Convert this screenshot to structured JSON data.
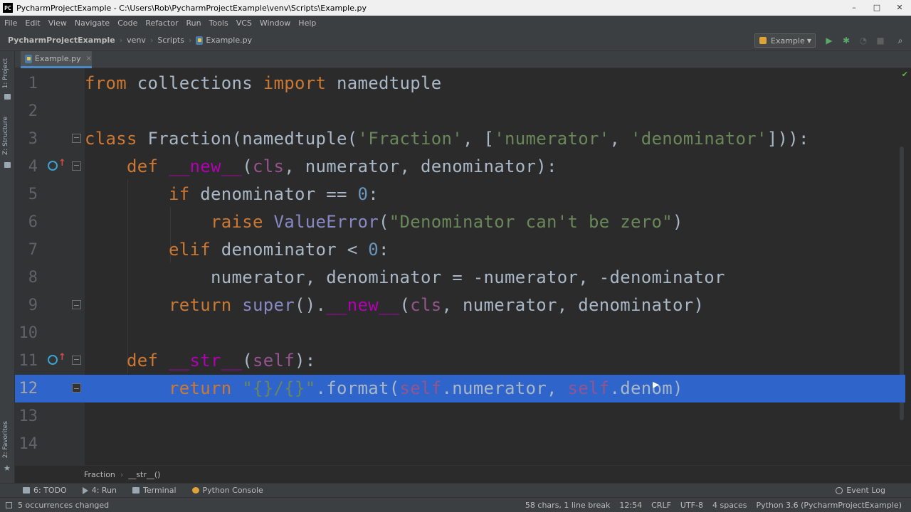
{
  "window": {
    "title": "PycharmProjectExample - C:\\Users\\Rob\\PycharmProjectExample\\venv\\Scripts\\Example.py",
    "app_icon_text": "PC",
    "controls": [
      "–",
      "□",
      "✕"
    ]
  },
  "menu": [
    "File",
    "Edit",
    "View",
    "Navigate",
    "Code",
    "Refactor",
    "Run",
    "Tools",
    "VCS",
    "Window",
    "Help"
  ],
  "navbar": {
    "breadcrumbs": [
      "PycharmProjectExample",
      "venv",
      "Scripts",
      "Example.py"
    ],
    "run_config": "Example"
  },
  "left_strip": {
    "project": "1: Project",
    "structure": "Z: Structure",
    "favorites": "2: Favorites"
  },
  "tabs": [
    {
      "label": "Example.py",
      "close": "×"
    }
  ],
  "editor": {
    "line_numbers": [
      "1",
      "2",
      "3",
      "4",
      "5",
      "6",
      "7",
      "8",
      "9",
      "10",
      "11",
      "12",
      "13",
      "14"
    ]
  },
  "code_breadcrumb": [
    "Fraction",
    "__str__()"
  ],
  "tool_windows": {
    "todo": "6: TODO",
    "run": "4: Run",
    "terminal": "Terminal",
    "python_console": "Python Console",
    "event_log": "Event Log"
  },
  "status": {
    "message": "5 occurrences changed",
    "selection_info": "58 chars, 1 line break",
    "position": "12:54",
    "line_sep": "CRLF",
    "encoding": "UTF-8",
    "indent": "4 spaces",
    "interpreter": "Python 3.6 (PycharmProjectExample)"
  },
  "colors": {
    "editor_bg": "#2b2b2b",
    "keyword": "#cc7832",
    "string": "#6a8759",
    "number": "#6897bb",
    "magic": "#b200b2",
    "selection": "#2f65ca"
  }
}
